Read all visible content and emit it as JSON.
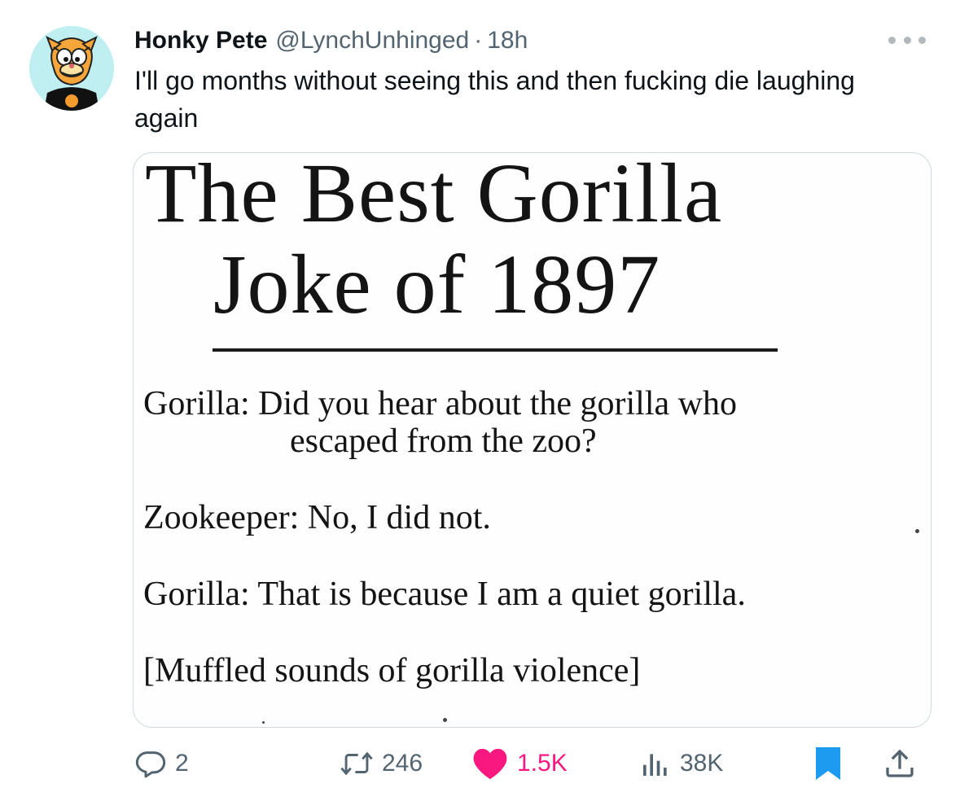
{
  "tweet": {
    "display_name": "Honky Pete",
    "handle": "@LynchUnhinged",
    "separator": "·",
    "timestamp": "18h",
    "text": "I'll go months without seeing this and then fucking die laughing again"
  },
  "media": {
    "title_line_1": "The Best Gorilla",
    "title_line_2": "Joke of 1897",
    "lines": [
      "Gorilla: Did you hear about the gorilla who",
      "escaped from the zoo?",
      "Zookeeper: No, I did not.",
      "Gorilla: That is because I am a quiet gorilla.",
      "[Muffled sounds of gorilla violence]"
    ]
  },
  "actions": {
    "replies": "2",
    "reposts": "246",
    "likes": "1.5K",
    "views": "38K"
  },
  "colors": {
    "text_primary": "#0f1419",
    "text_secondary": "#536471",
    "like": "#f91880",
    "bookmark": "#1d9bf0",
    "avatar_bg": "#bfeff0"
  },
  "icons": {
    "reply": "speech-bubble-icon",
    "repost": "repost-arrows-icon",
    "like": "heart-filled-icon",
    "views": "bar-chart-icon",
    "bookmark": "bookmark-filled-icon",
    "share": "share-upload-icon",
    "more": "more-dots-icon"
  }
}
